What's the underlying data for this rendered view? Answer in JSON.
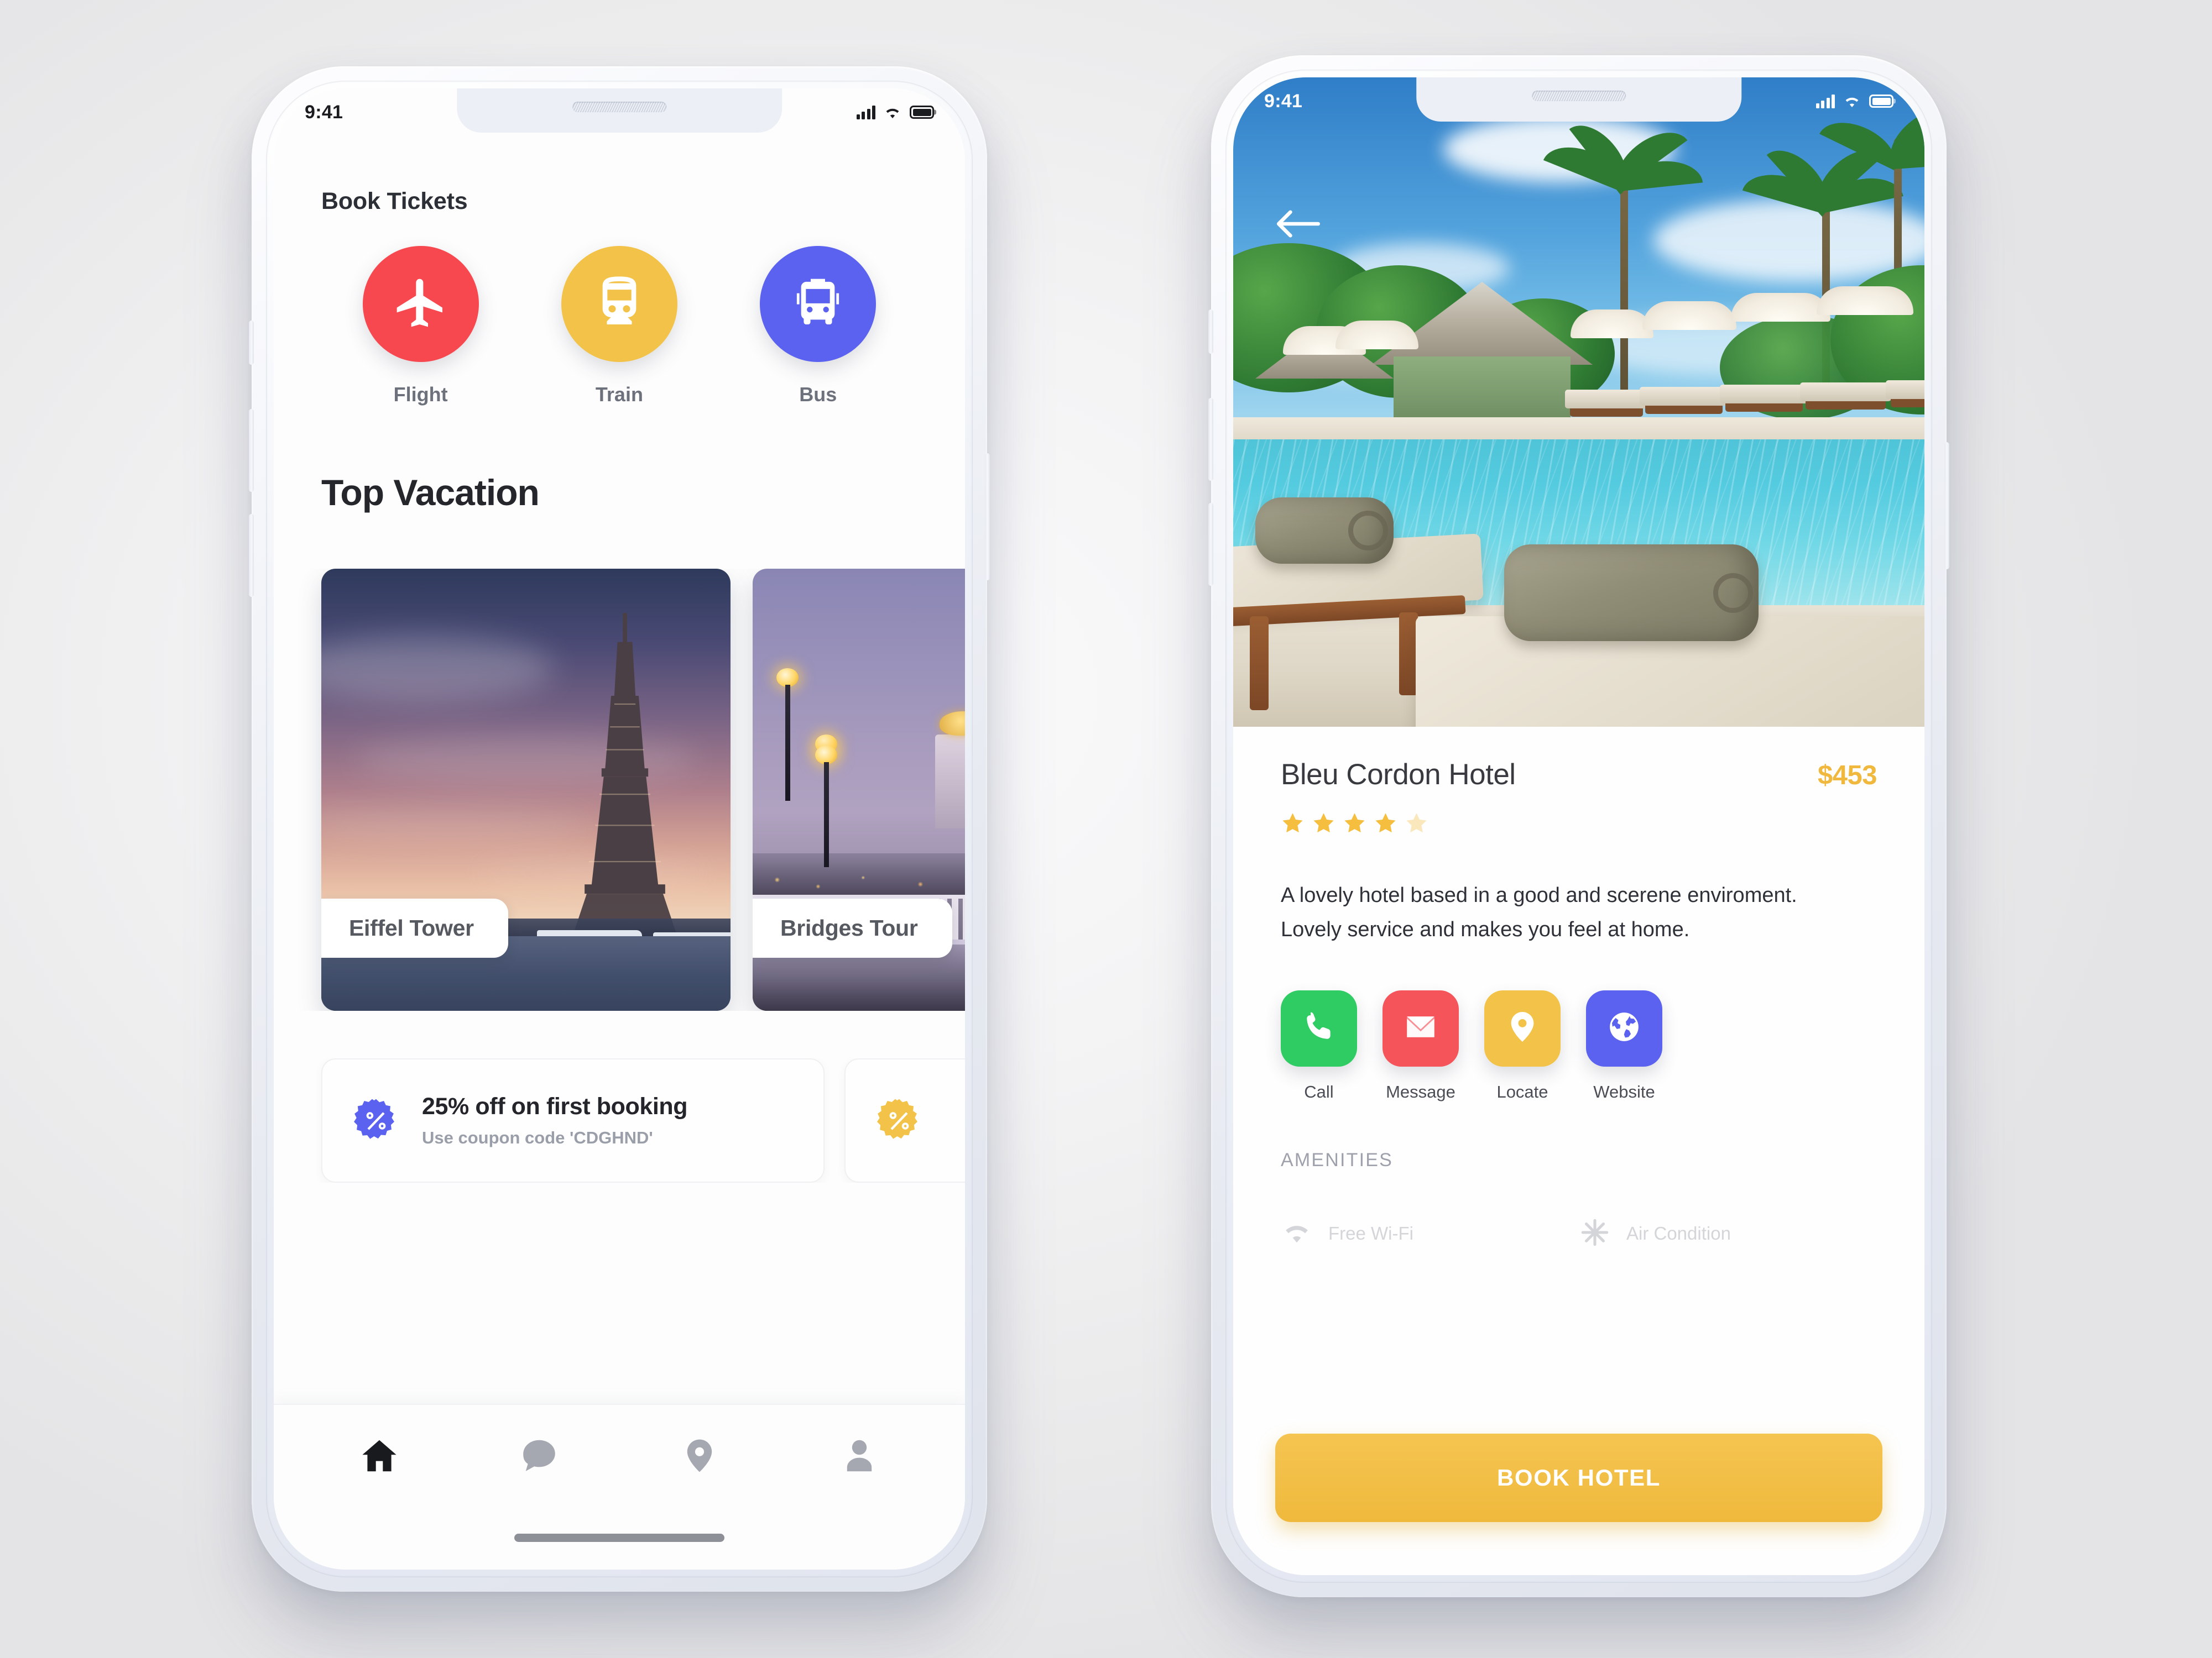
{
  "statusbar": {
    "time": "9:41",
    "icons": [
      "signal-icon",
      "wifi-icon",
      "battery-icon"
    ]
  },
  "home_screen": {
    "book_tickets": {
      "heading": "Book Tickets",
      "options": [
        {
          "label": "Flight",
          "icon": "airplane-icon",
          "color": "#F8484F"
        },
        {
          "label": "Train",
          "icon": "train-icon",
          "color": "#F3C349"
        },
        {
          "label": "Bus",
          "icon": "bus-icon",
          "color": "#5B62F0"
        }
      ]
    },
    "top_vacation": {
      "heading": "Top Vacation",
      "cards": [
        {
          "label": "Eiffel Tower",
          "image": "eiffel-tower-at-dusk"
        },
        {
          "label": "Bridges Tour",
          "image": "paris-bridge-lamps-at-dusk"
        }
      ]
    },
    "coupons": [
      {
        "icon": "percent-badge-icon",
        "color": "#5B62F0",
        "title": "25% off on first booking",
        "subtitle": "Use coupon code 'CDGHND'"
      },
      {
        "icon": "percent-badge-icon",
        "color": "#F3C349",
        "title": "",
        "subtitle": ""
      }
    ],
    "tabbar": [
      {
        "name": "home",
        "icon": "home-icon",
        "active": true
      },
      {
        "name": "messages",
        "icon": "chat-icon",
        "active": false
      },
      {
        "name": "places",
        "icon": "location-icon",
        "active": false
      },
      {
        "name": "profile",
        "icon": "person-icon",
        "active": false
      }
    ]
  },
  "hotel_screen": {
    "back_icon": "arrow-left-icon",
    "hero_image": "tropical-resort-pool-with-loungers",
    "name": "Bleu Cordon Hotel",
    "price": "$453",
    "rating": {
      "filled": 4,
      "total": 5,
      "filled_color": "#F6BE3E",
      "empty_color": "#FAE7BC"
    },
    "description": "A lovely hotel based in a good and scerene enviroment. Lovely service and makes you feel at home.",
    "actions": [
      {
        "label": "Call",
        "icon": "phone-icon",
        "color": "#2FCB63"
      },
      {
        "label": "Message",
        "icon": "envelope-icon",
        "color": "#F6545B"
      },
      {
        "label": "Locate",
        "icon": "location-icon",
        "color": "#F3C349"
      },
      {
        "label": "Website",
        "icon": "globe-icon",
        "color": "#5B62F0"
      }
    ],
    "amenities_heading": "AMENITIES",
    "amenities": [
      {
        "label": "Free Wi-Fi",
        "icon": "wifi-icon"
      },
      {
        "label": "Air Condition",
        "icon": "air-condition-icon"
      }
    ],
    "cta_label": "BOOK HOTEL"
  }
}
